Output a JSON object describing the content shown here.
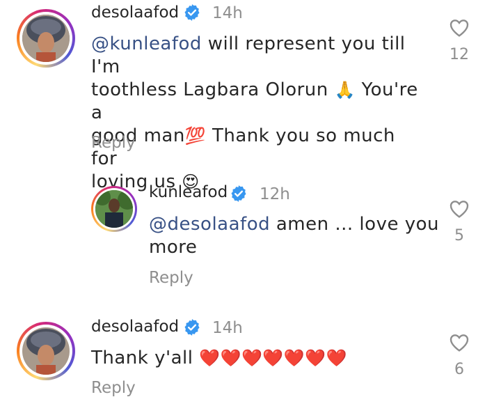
{
  "comments": [
    {
      "username": "desolaafod",
      "time": "14h",
      "mention": "@kunleafod",
      "text_l1_rest": " will represent you till I'm",
      "text_l2": "toothless Lagbara Olorun ",
      "emoji_pray": "🙏",
      "text_l2_rest": " You're a",
      "text_l3": "good man",
      "emoji_100": "💯",
      "text_l3_rest": " Thank you so much for",
      "text_l4": "loving us ",
      "emoji_heart_eyes": "😍",
      "reply_label": "Reply",
      "likes": "12"
    },
    {
      "username": "kunleafod",
      "time": "12h",
      "mention": "@desolaafod",
      "text_l1_rest": " amen ... love you",
      "text_l2": "more",
      "reply_label": "Reply",
      "likes": "5"
    },
    {
      "username": "desolaafod",
      "time": "14h",
      "text_l1": "Thank y'all ",
      "hearts": "❤️❤️❤️❤️❤️❤️❤️",
      "reply_label": "Reply",
      "likes": "6"
    }
  ],
  "colors": {
    "text": "#262626",
    "muted": "#8e8e8e",
    "mention": "#385185",
    "verified": "#3897f0"
  },
  "icons": [
    "verified-badge-icon",
    "heart-outline-icon"
  ]
}
